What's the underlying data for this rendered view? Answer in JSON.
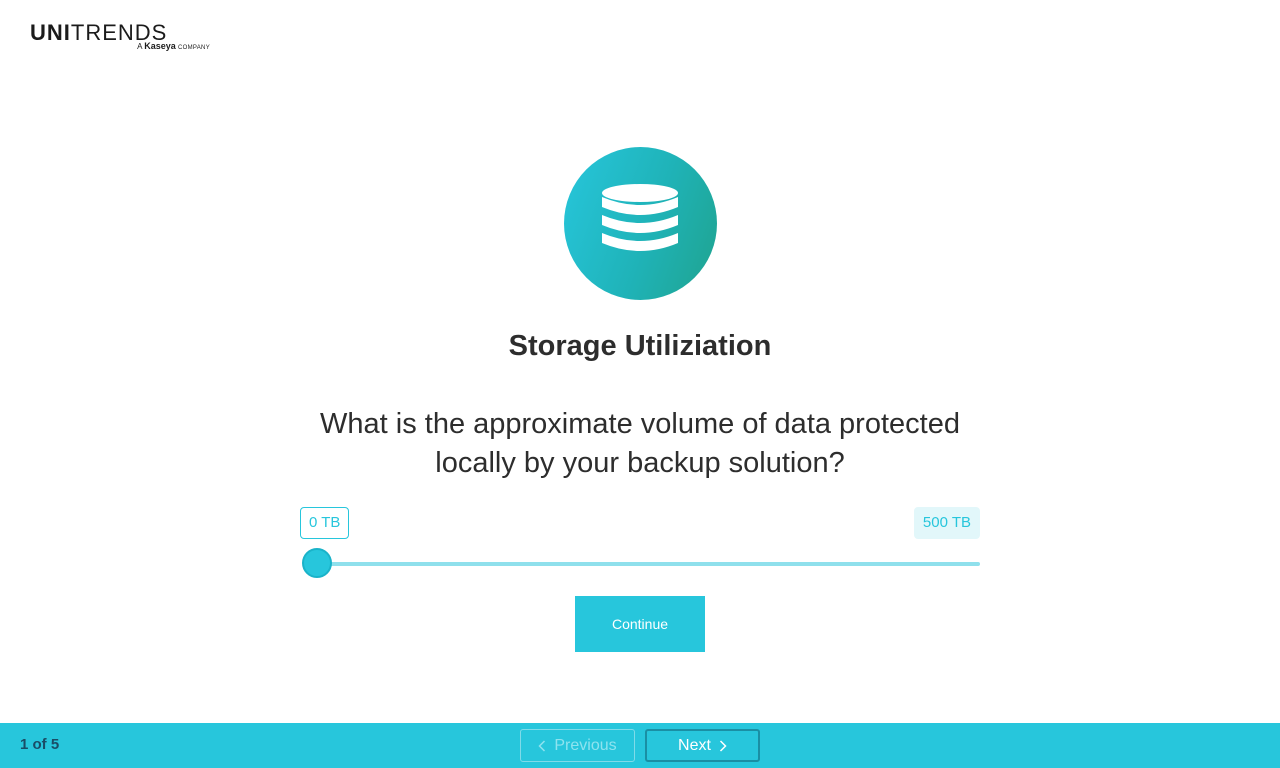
{
  "logo": {
    "brand_bold": "UNI",
    "brand_light": "TRENDS",
    "sub_prefix": "A",
    "sub_name": "Kaseya",
    "sub_suffix": "COMPANY"
  },
  "icon": {
    "name": "database-icon"
  },
  "page": {
    "title": "Storage Utiliziation",
    "question": "What is the approximate volume of data protected locally by your backup solution?"
  },
  "slider": {
    "min_label": "0 TB",
    "max_label": "500 TB",
    "min": 0,
    "max": 500,
    "value": 0
  },
  "continue_label": "Continue",
  "footer": {
    "step": "1 of 5",
    "previous_label": "Previous",
    "next_label": "Next"
  },
  "colors": {
    "accent": "#27c6dc",
    "track": "#8fe0ec",
    "text": "#2d2d2d",
    "step_text": "#1a4d66"
  }
}
